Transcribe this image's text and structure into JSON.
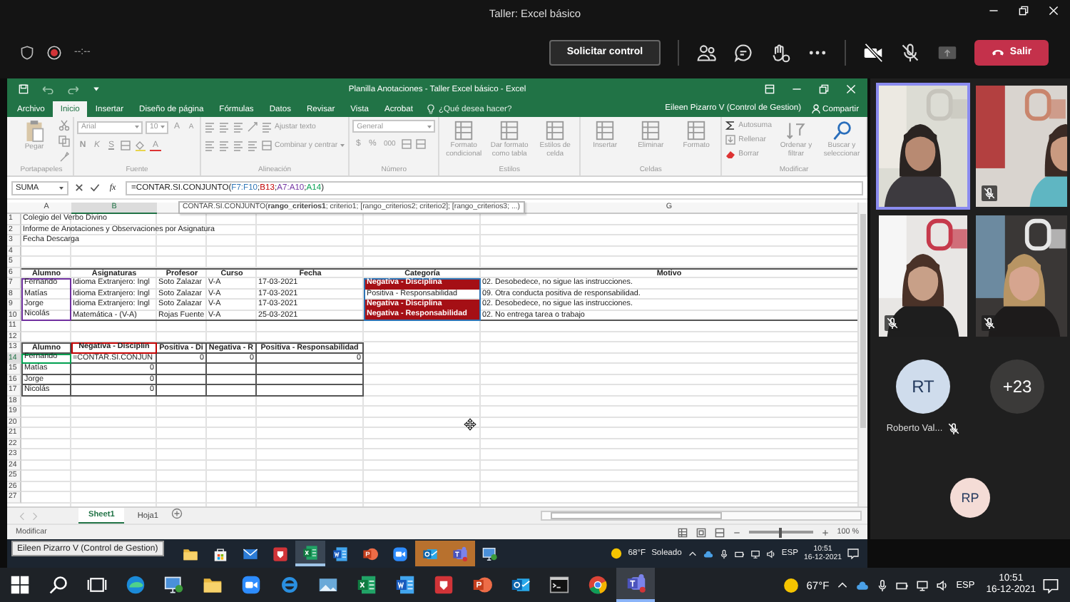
{
  "meeting": {
    "title": "Taller: Excel básico",
    "timer": "--:--",
    "request_button": "Solicitar control",
    "leave_button": "Salir"
  },
  "excel": {
    "title": "Planilla Anotaciones - Taller Excel básico - Excel",
    "tabs": [
      {
        "label": "Archivo",
        "selected": false
      },
      {
        "label": "Inicio",
        "selected": true
      },
      {
        "label": "Insertar",
        "selected": false
      },
      {
        "label": "Diseño de página",
        "selected": false
      },
      {
        "label": "Fórmulas",
        "selected": false
      },
      {
        "label": "Datos",
        "selected": false
      },
      {
        "label": "Revisar",
        "selected": false
      },
      {
        "label": "Vista",
        "selected": false
      },
      {
        "label": "Acrobat",
        "selected": false
      }
    ],
    "tell_me": "¿Qué desea hacer?",
    "user": "Eileen Pizarro V (Control de Gestion)",
    "share": "Compartir",
    "ribbon": {
      "disabled": true,
      "groups": [
        {
          "kind": "clipboard",
          "label": "Portapapeles",
          "paste": "Pegar"
        },
        {
          "kind": "font",
          "label": "Fuente",
          "font": "Arial",
          "size": "10",
          "grow": "A",
          "shrink": "A",
          "styles": [
            "N",
            "K",
            "S"
          ],
          "color_button": "A"
        },
        {
          "kind": "alignment",
          "label": "Alineación",
          "wrap": "Ajustar texto",
          "merge": "Combinar y centrar"
        },
        {
          "kind": "number",
          "label": "Número",
          "format": "General",
          "currency": "$",
          "percent": "%",
          "thousands": "000"
        },
        {
          "kind": "styles",
          "label": "Estilos",
          "buttons": [
            "Formato condicional",
            "Dar formato como tabla",
            "Estilos de celda"
          ]
        },
        {
          "kind": "cells",
          "label": "Celdas",
          "buttons": [
            "Insertar",
            "Eliminar",
            "Formato"
          ]
        },
        {
          "kind": "editing",
          "label": "Modificar",
          "items": [
            "Autosuma",
            "Rellenar",
            "Borrar"
          ],
          "buttons": [
            "Ordenar y filtrar",
            "Buscar y seleccionar"
          ]
        }
      ]
    },
    "formula_bar": {
      "name_box": "SUMA",
      "fx": "fx",
      "formula": [
        {
          "text": "=CONTAR.SI.CONJUNTO("
        },
        {
          "text": "F7:F10",
          "color": "#2e75b6"
        },
        {
          "text": ";"
        },
        {
          "text": "B13",
          "color": "#c00000"
        },
        {
          "text": ";"
        },
        {
          "text": "A7:A10",
          "color": "#7030a0"
        },
        {
          "text": ";"
        },
        {
          "text": "A14",
          "color": "#00a050"
        },
        {
          "text": ")"
        }
      ]
    },
    "tooltip": "CONTAR.SI.CONJUNTO(**rango_criterios1**; criterio1; [rango_criterios2; criterio2]; [rango_criterios3; ...)",
    "columns": [
      {
        "label": "A",
        "selected": false
      },
      {
        "label": "B",
        "selected": true
      },
      {},
      {},
      {},
      {},
      {
        "label": "G",
        "selected": false
      }
    ],
    "rows": [
      {
        "n": "1",
        "kind": "text",
        "selected": false,
        "cells": {
          "A": "Colegio del Verbo Divino"
        }
      },
      {
        "n": "2",
        "kind": "text",
        "selected": false,
        "cells": {
          "A": "Informe de Anotaciones y Observaciones por Asignatura"
        }
      },
      {
        "n": "3",
        "kind": "text",
        "selected": false,
        "cells": {
          "A": "Fecha Descarga"
        }
      },
      {
        "n": "4",
        "kind": "blank",
        "selected": false
      },
      {
        "n": "5",
        "kind": "blank",
        "selected": false
      },
      {
        "n": "6",
        "kind": "header",
        "selected": false,
        "cells": {
          "A": "Alumno",
          "B": "Asignaturas",
          "C": "Profesor",
          "D": "Curso",
          "E": "Fecha",
          "F": "Categoría",
          "G": "Motivo"
        }
      },
      {
        "n": "7",
        "kind": "data",
        "selected": false,
        "cells": {
          "A": {
            "text": "Fernando",
            "outline": {
              "color": "#7030a0"
            }
          },
          "B": "Idioma Extranjero: Ingl",
          "C": "Soto Zalazar",
          "D": "V-A",
          "E": "17-03-2021",
          "F": {
            "text": "Negativa - Disciplina",
            "color": "#a50f15",
            "outline": {
              "color": "#2e75b6"
            }
          },
          "G": "02. Desobedece, no sigue las instrucciones."
        }
      },
      {
        "n": "8",
        "kind": "data",
        "selected": false,
        "cells": {
          "A": {
            "text": "Matías",
            "outline": {
              "color": "#7030a0"
            }
          },
          "B": "Idioma Extranjero: Ingl",
          "C": "Soto Zalazar",
          "D": "V-A",
          "E": "17-03-2021",
          "F": {
            "text": "Positiva - Responsabilidad",
            "outline": {
              "color": "#2e75b6"
            }
          },
          "G": "09. Otra conducta positiva de responsabilidad."
        }
      },
      {
        "n": "9",
        "kind": "data",
        "selected": false,
        "cells": {
          "A": {
            "text": "Jorge",
            "outline": {
              "color": "#7030a0"
            }
          },
          "B": "Idioma Extranjero: Ingl",
          "C": "Soto Zalazar",
          "D": "V-A",
          "E": "17-03-2021",
          "F": {
            "text": "Negativa - Disciplina",
            "color": "#a50f15",
            "outline": {
              "color": "#2e75b6"
            }
          },
          "G": "02. Desobedece, no sigue las instrucciones."
        }
      },
      {
        "n": "10",
        "kind": "data_end",
        "selected": false,
        "cells": {
          "A": {
            "text": "Nicolás",
            "outline": {
              "color": "#7030a0"
            }
          },
          "B": "Matemática - (V-A)",
          "C": "Rojas Fuente",
          "D": "V-A",
          "E": "25-03-2021",
          "F": {
            "text": "Negativa - Responsabilidad",
            "color": "#a50f15",
            "outline": {
              "color": "#2e75b6"
            }
          },
          "G": "02. No entrega tarea o trabajo"
        }
      },
      {
        "n": "11",
        "kind": "blank",
        "selected": false
      },
      {
        "n": "12",
        "kind": "blank",
        "selected": false
      },
      {
        "n": "13",
        "kind": "summary_header",
        "selected": false,
        "cells": {
          "A": "Alumno",
          "B": {
            "text": "Negativa - Disciplin",
            "outline": {
              "color": "#c00000"
            }
          },
          "C": "Positiva - Di",
          "D": "Negativa - R",
          "E": "Positiva - Responsabilidad"
        }
      },
      {
        "n": "14",
        "kind": "summary",
        "selected": true,
        "cells": {
          "A": {
            "text": "Fernando",
            "outline": {
              "color": "#00a050"
            }
          },
          "B": "=CONTAR.SI.CONJUN",
          "C": {
            "text": "0",
            "kind": "number"
          },
          "D": {
            "text": "0",
            "kind": "number"
          },
          "E": {
            "text": "0",
            "kind": "number"
          }
        }
      },
      {
        "n": "15",
        "kind": "summary",
        "selected": false,
        "cells": {
          "A": "Matías",
          "B": {
            "text": "0",
            "kind": "number"
          }
        }
      },
      {
        "n": "16",
        "kind": "summary",
        "selected": false,
        "cells": {
          "A": "Jorge",
          "B": {
            "text": "0",
            "kind": "number"
          }
        }
      },
      {
        "n": "17",
        "kind": "summary",
        "selected": false,
        "cells": {
          "A": "Nicolás",
          "B": {
            "text": "0",
            "kind": "number"
          }
        }
      },
      {
        "n": "18",
        "kind": "blank",
        "selected": false
      },
      {
        "n": "19",
        "kind": "blank",
        "selected": false
      },
      {
        "n": "20",
        "kind": "blank",
        "selected": false
      },
      {
        "n": "21",
        "kind": "blank",
        "selected": false
      },
      {
        "n": "22",
        "kind": "blank",
        "selected": false
      },
      {
        "n": "23",
        "kind": "blank",
        "selected": false
      },
      {
        "n": "24",
        "kind": "blank",
        "selected": false
      },
      {
        "n": "25",
        "kind": "blank",
        "selected": false
      },
      {
        "n": "26",
        "kind": "blank",
        "selected": false
      },
      {
        "n": "27",
        "kind": "blank",
        "selected": false
      }
    ],
    "sheet_tabs": [
      {
        "label": "Sheet1",
        "selected": true
      },
      {
        "label": "Hoja1",
        "selected": false
      }
    ],
    "status": "Modificar",
    "zoom": {
      "label": "100 %",
      "level": 0.5
    }
  },
  "participants": {
    "tiles": [
      {
        "kind": "picture",
        "speaking": true,
        "muted": false
      },
      {
        "kind": "picture",
        "speaking": false,
        "muted": true
      },
      {
        "kind": "picture",
        "speaking": false,
        "muted": true
      },
      {
        "kind": "picture",
        "speaking": false,
        "muted": true
      }
    ],
    "avatars": [
      {
        "initials": "RT",
        "color": "#cfdcec",
        "name": "Roberto Val...",
        "muted": true
      },
      {
        "initials": "+23",
        "color": "#3b3a39"
      },
      {
        "initials": "RP",
        "color": "#f4dcd6"
      }
    ]
  },
  "shared_taskbar": {
    "tooltip": "Eileen Pizarro V (Control de Gestion)",
    "apps": [
      {
        "kind": "folder",
        "selected": false,
        "flashing": false
      },
      {
        "kind": "store",
        "selected": false,
        "flashing": false
      },
      {
        "kind": "mail",
        "selected": false,
        "flashing": false
      },
      {
        "kind": "shield",
        "selected": false,
        "flashing": false
      },
      {
        "kind": "spreadsheet",
        "selected": true,
        "flashing": false
      },
      {
        "kind": "document",
        "selected": false,
        "flashing": false
      },
      {
        "kind": "presentation",
        "selected": false,
        "flashing": false
      },
      {
        "kind": "video",
        "selected": false,
        "flashing": false
      },
      {
        "kind": "outlook",
        "selected": false,
        "flashing": true
      },
      {
        "kind": "chat",
        "selected": false,
        "flashing": true
      },
      {
        "kind": "monitor",
        "selected": false,
        "flashing": false
      }
    ],
    "temperature": "68°F",
    "weather": "Soleado",
    "language": "ESP",
    "time": "10:51",
    "date": "16-12-2021"
  },
  "taskbar": {
    "apps": [
      {
        "kind": "start",
        "selected": false
      },
      {
        "kind": "search",
        "selected": false
      },
      {
        "kind": "taskview",
        "selected": false
      },
      {
        "kind": "edge",
        "selected": false
      },
      {
        "kind": "monitor",
        "selected": false
      },
      {
        "kind": "folder",
        "selected": false
      },
      {
        "kind": "video",
        "selected": false
      },
      {
        "kind": "ie",
        "selected": false
      },
      {
        "kind": "photos",
        "selected": false
      },
      {
        "kind": "spreadsheet",
        "selected": false
      },
      {
        "kind": "document",
        "selected": false
      },
      {
        "kind": "shield",
        "selected": false
      },
      {
        "kind": "presentation",
        "selected": false
      },
      {
        "kind": "outlook",
        "selected": false
      },
      {
        "kind": "terminal",
        "selected": false
      },
      {
        "kind": "chrome",
        "selected": false
      },
      {
        "kind": "chat",
        "selected": true
      }
    ],
    "temperature": "67°F",
    "language": "ESP",
    "time": "10:51",
    "date": "16-12-2021"
  }
}
